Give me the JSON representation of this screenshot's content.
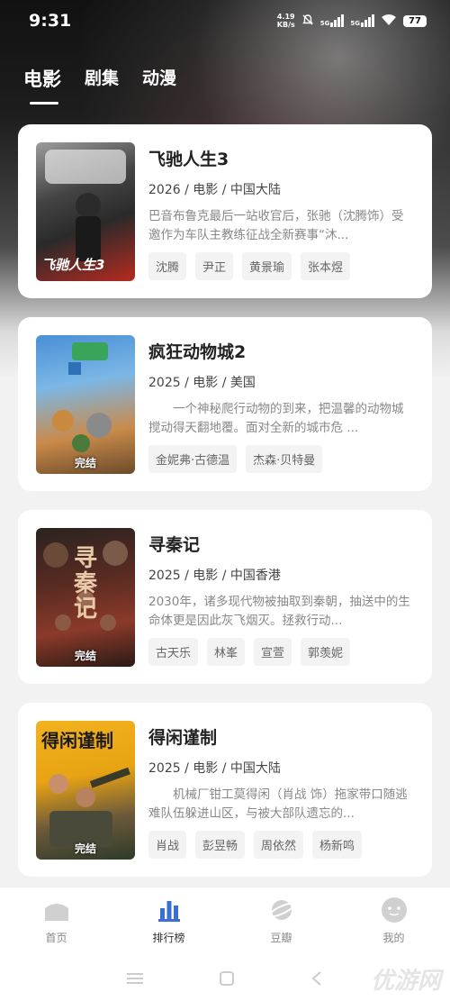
{
  "status": {
    "time": "9:31",
    "net_speed_value": "4.19",
    "net_speed_unit": "KB/s",
    "sim1": "5G",
    "sim2": "5G",
    "battery": "77"
  },
  "tabs": [
    {
      "label": "电影",
      "active": true
    },
    {
      "label": "剧集",
      "active": false
    },
    {
      "label": "动漫",
      "active": false
    }
  ],
  "movies": [
    {
      "title": "飞驰人生3",
      "meta": "2026 / 电影 / 中国大陆",
      "desc": "巴音布鲁克最后一站收官后，张驰（沈腾饰）受邀作为车队主教练征战全新赛事“沐...",
      "cast": [
        "沈腾",
        "尹正",
        "黄景瑜",
        "张本煜"
      ],
      "poster_title": "飞驰人生3",
      "badge": ""
    },
    {
      "title": "疯狂动物城2",
      "meta": "2025 / 电影 / 美国",
      "desc": "　　一个神秘爬行动物的到来，把温馨的动物城搅动得天翻地覆。面对全新的城市危 ...",
      "cast": [
        "金妮弗·古德温",
        "杰森·贝特曼"
      ],
      "poster_title": "",
      "badge": "完结"
    },
    {
      "title": "寻秦记",
      "meta": "2025 / 电影 / 中国香港",
      "desc": "2030年，诸多现代物被抽取到秦朝，抽送中的生命体更是因此灰飞烟灭。拯救行动...",
      "cast": [
        "古天乐",
        "林峯",
        "宣萱",
        "郭羡妮"
      ],
      "poster_title": "寻秦记",
      "badge": "完结"
    },
    {
      "title": "得闲谨制",
      "meta": "2025 / 电影 / 中国大陆",
      "desc": "　　机械厂钳工莫得闲（肖战 饰）拖家带口随逃难队伍躲进山区，与被大部队遗忘的...",
      "cast": [
        "肖战",
        "彭昱畅",
        "周依然",
        "杨新鸣"
      ],
      "poster_title": "得闲谨制",
      "badge": "完结"
    }
  ],
  "bottom_nav": [
    {
      "label": "首页",
      "icon": "home-icon",
      "active": false
    },
    {
      "label": "排行榜",
      "icon": "ranking-icon",
      "active": true
    },
    {
      "label": "豆瓣",
      "icon": "planet-icon",
      "active": false
    },
    {
      "label": "我的",
      "icon": "profile-icon",
      "active": false
    }
  ],
  "watermark": "优游网",
  "colors": {
    "accent": "#3b6fd8",
    "inactive_icon": "#d0d0d0"
  }
}
